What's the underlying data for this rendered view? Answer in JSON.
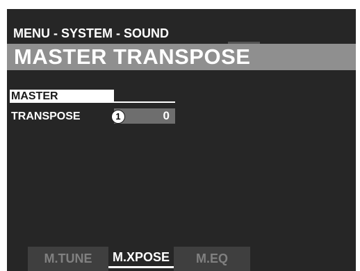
{
  "header": {
    "breadcrumb": "MENU - SYSTEM - SOUND",
    "title": "MASTER TRANSPOSE"
  },
  "content": {
    "group_label": "MASTER",
    "param_label": "TRANSPOSE",
    "param_value": "0",
    "callout_number": "1"
  },
  "tabs": [
    {
      "label": "M.TUNE",
      "active": false
    },
    {
      "label": "M.XPOSE",
      "active": true
    },
    {
      "label": "M.EQ",
      "active": false
    }
  ],
  "colors": {
    "screen_bg": "#262626",
    "title_bar": "#8f8f8f",
    "value_box": "#6e6e6e",
    "inactive_tab": "#3f3f3f",
    "text": "#ffffff"
  }
}
